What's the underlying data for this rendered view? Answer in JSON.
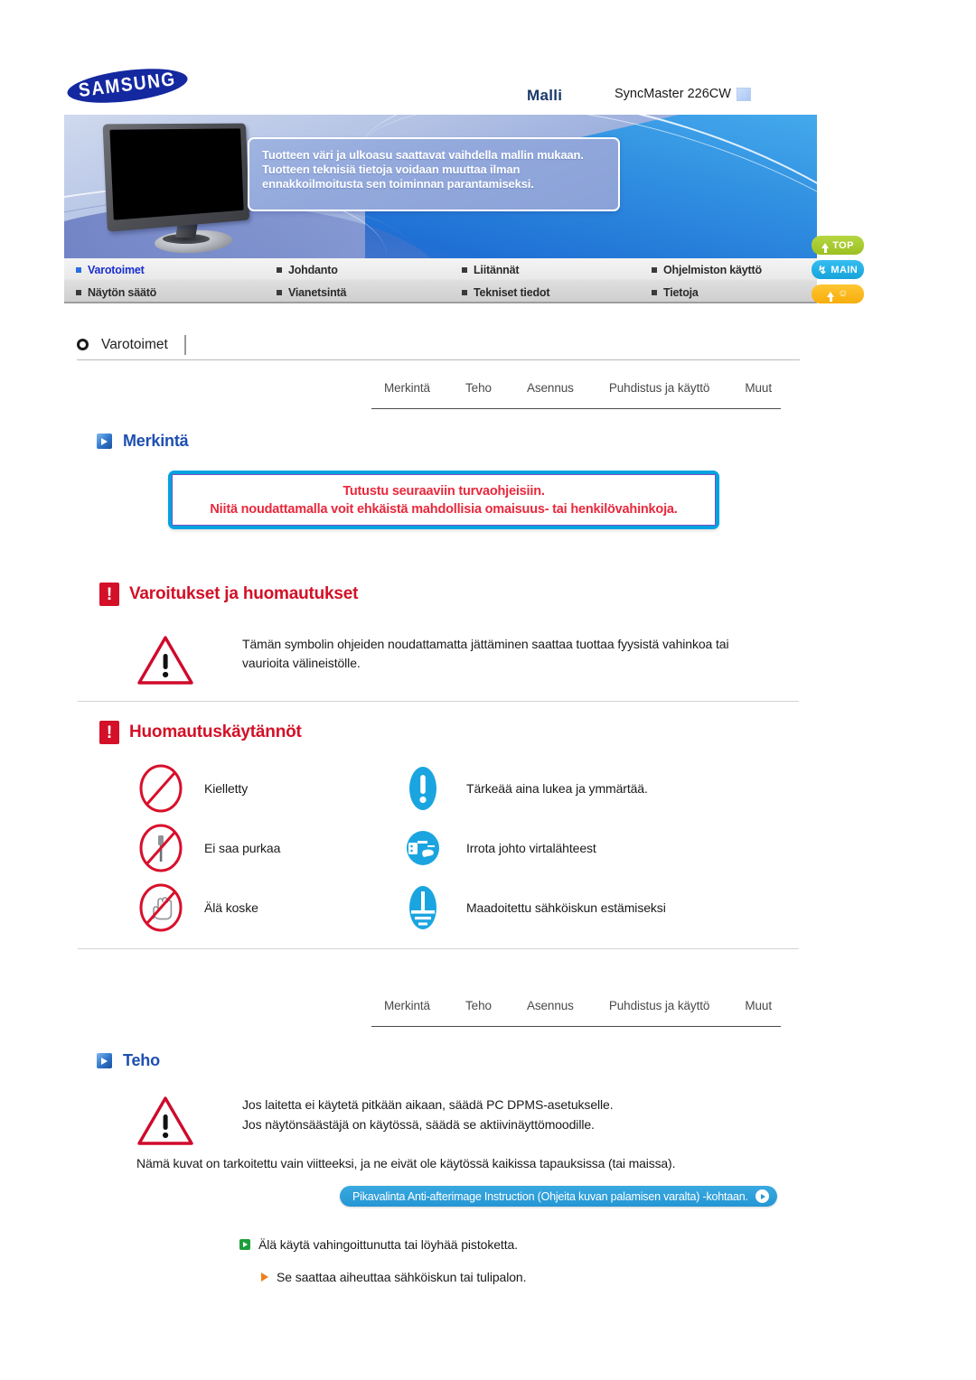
{
  "header": {
    "brand": "SAMSUNG",
    "model_label": "Malli",
    "model_value": "SyncMaster 226CW"
  },
  "banner": {
    "notice": "Tuotteen väri ja ulkoasu saattavat vaihdella mallin mukaan. Tuotteen teknisiä tietoja voidaan muuttaa ilman ennakkoilmoitusta sen toiminnan parantamiseksi."
  },
  "nav": {
    "items": [
      {
        "label": "Varotoimet",
        "active": true
      },
      {
        "label": "Johdanto",
        "active": false
      },
      {
        "label": "Liitännät",
        "active": false
      },
      {
        "label": "Ohjelmiston käyttö",
        "active": false
      },
      {
        "label": "Näytön säätö",
        "active": false
      },
      {
        "label": "Vianetsintä",
        "active": false
      },
      {
        "label": "Tekniset tiedot",
        "active": false
      },
      {
        "label": "Tietoja",
        "active": false
      }
    ]
  },
  "side_buttons": [
    {
      "label": "TOP",
      "icon": "arrow-up-icon",
      "color": "#a8cc2f"
    },
    {
      "label": "MAIN",
      "icon": "home-arrow-icon",
      "color": "#22b0e6"
    },
    {
      "label": "",
      "icon": "smile-icon",
      "color": "#fbb416"
    }
  ],
  "page": {
    "title": "Varotoimet"
  },
  "tabs": [
    "Merkintä",
    "Teho",
    "Asennus",
    "Puhdistus ja käyttö",
    "Muut"
  ],
  "sections": {
    "merkinta": {
      "heading": "Merkintä",
      "safety_box": {
        "line1": "Tutustu seuraaviin turvaohjeisiin.",
        "line2": "Niitä noudattamalla voit ehkäistä mahdollisia omaisuus- tai henkilövahinkoja."
      }
    },
    "varoitukset": {
      "heading": "Varoitukset ja huomautukset",
      "body": "Tämän symbolin ohjeiden noudattamatta jättäminen saattaa tuottaa fyysistä vahinkoa tai vaurioita välineistölle."
    },
    "huomautuskaytannot": {
      "heading": "Huomautuskäytännöt",
      "items": [
        {
          "icon": "prohibited-icon",
          "label": "Kielletty"
        },
        {
          "icon": "exclamation-circle-icon",
          "label": "Tärkeää aina lukea ja ymmärtää."
        },
        {
          "icon": "no-disassemble-icon",
          "label": "Ei saa purkaa"
        },
        {
          "icon": "unplug-icon",
          "label": "Irrota johto virtalähteest"
        },
        {
          "icon": "do-not-touch-icon",
          "label": "Älä koske"
        },
        {
          "icon": "ground-icon",
          "label": "Maadoitettu sähköiskun estämiseksi"
        }
      ]
    },
    "teho": {
      "heading": "Teho",
      "body_line1": "Jos laitetta ei käytetä pitkään aikaan, säädä PC DPMS-asetukselle.",
      "body_line2": "Jos näytönsäästäjä on käytössä, säädä se aktiivinäyttömoodille.",
      "note": "Nämä kuvat on tarkoitettu vain viitteeksi, ja ne eivät ole käytössä kaikissa tapauksissa (tai maissa).",
      "link_pill": "Pikavalinta Anti-afterimage Instruction (Ohjeita kuvan palamisen varalta) -kohtaan.",
      "bullet_main": "Älä käytä vahingoittunutta tai löyhää pistoketta.",
      "bullet_sub": "Se saattaa aiheuttaa sähköiskun tai tulipalon."
    }
  },
  "colors": {
    "brand_blue": "#1428a0",
    "heading_blue": "#1d4fb0",
    "warning_red": "#d31027",
    "safety_red": "#e8283c",
    "box_cyan": "#00a2e0",
    "notice_blue": "#22b0e6",
    "green": "#1e9e3a",
    "orange": "#f07f1a"
  }
}
